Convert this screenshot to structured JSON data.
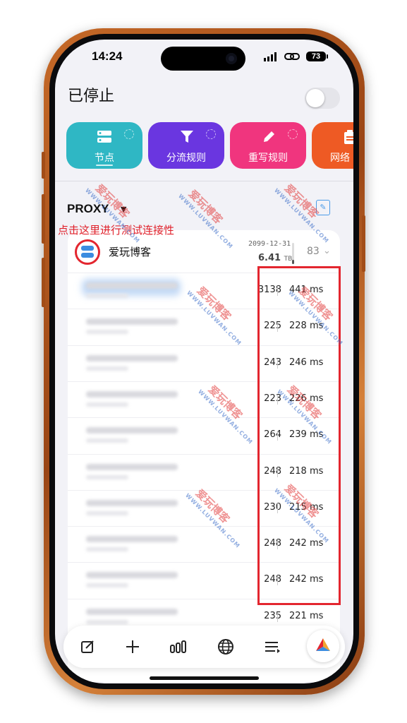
{
  "status_bar": {
    "time": "14:24",
    "battery": "73"
  },
  "header": {
    "title": "已停止"
  },
  "tabs": [
    {
      "label": "节点",
      "icon": "server-icon",
      "color": "#2fb7c4"
    },
    {
      "label": "分流规则",
      "icon": "filter-icon",
      "color": "#6a36e0"
    },
    {
      "label": "重写规则",
      "icon": "pencil-icon",
      "color": "#f0357e"
    },
    {
      "label": "网络",
      "icon": "clipboard-icon",
      "color": "#ee5a24"
    }
  ],
  "section": {
    "title": "PROXY"
  },
  "annotation": "点击这里进行测试连接性",
  "group": {
    "name": "爱玩博客",
    "expiry": "2099-12-31",
    "traffic": "6.41",
    "traffic_unit": "TB",
    "count": "83"
  },
  "nodes": [
    {
      "a": "3138",
      "b": "441 ms"
    },
    {
      "a": "225",
      "b": "228 ms"
    },
    {
      "a": "243",
      "b": "246 ms"
    },
    {
      "a": "223",
      "b": "226 ms"
    },
    {
      "a": "264",
      "b": "239 ms"
    },
    {
      "a": "248",
      "b": "218 ms"
    },
    {
      "a": "230",
      "b": "215 ms"
    },
    {
      "a": "248",
      "b": "242 ms"
    },
    {
      "a": "248",
      "b": "242 ms"
    },
    {
      "a": "235",
      "b": "221 ms"
    }
  ],
  "watermark": {
    "text": "爱玩博客",
    "sub": "WWW.LUVWAN.COM"
  },
  "bottom_nav": [
    "edit-icon",
    "plus-icon",
    "stats-icon",
    "globe-icon",
    "list-icon",
    "app-logo-icon"
  ]
}
